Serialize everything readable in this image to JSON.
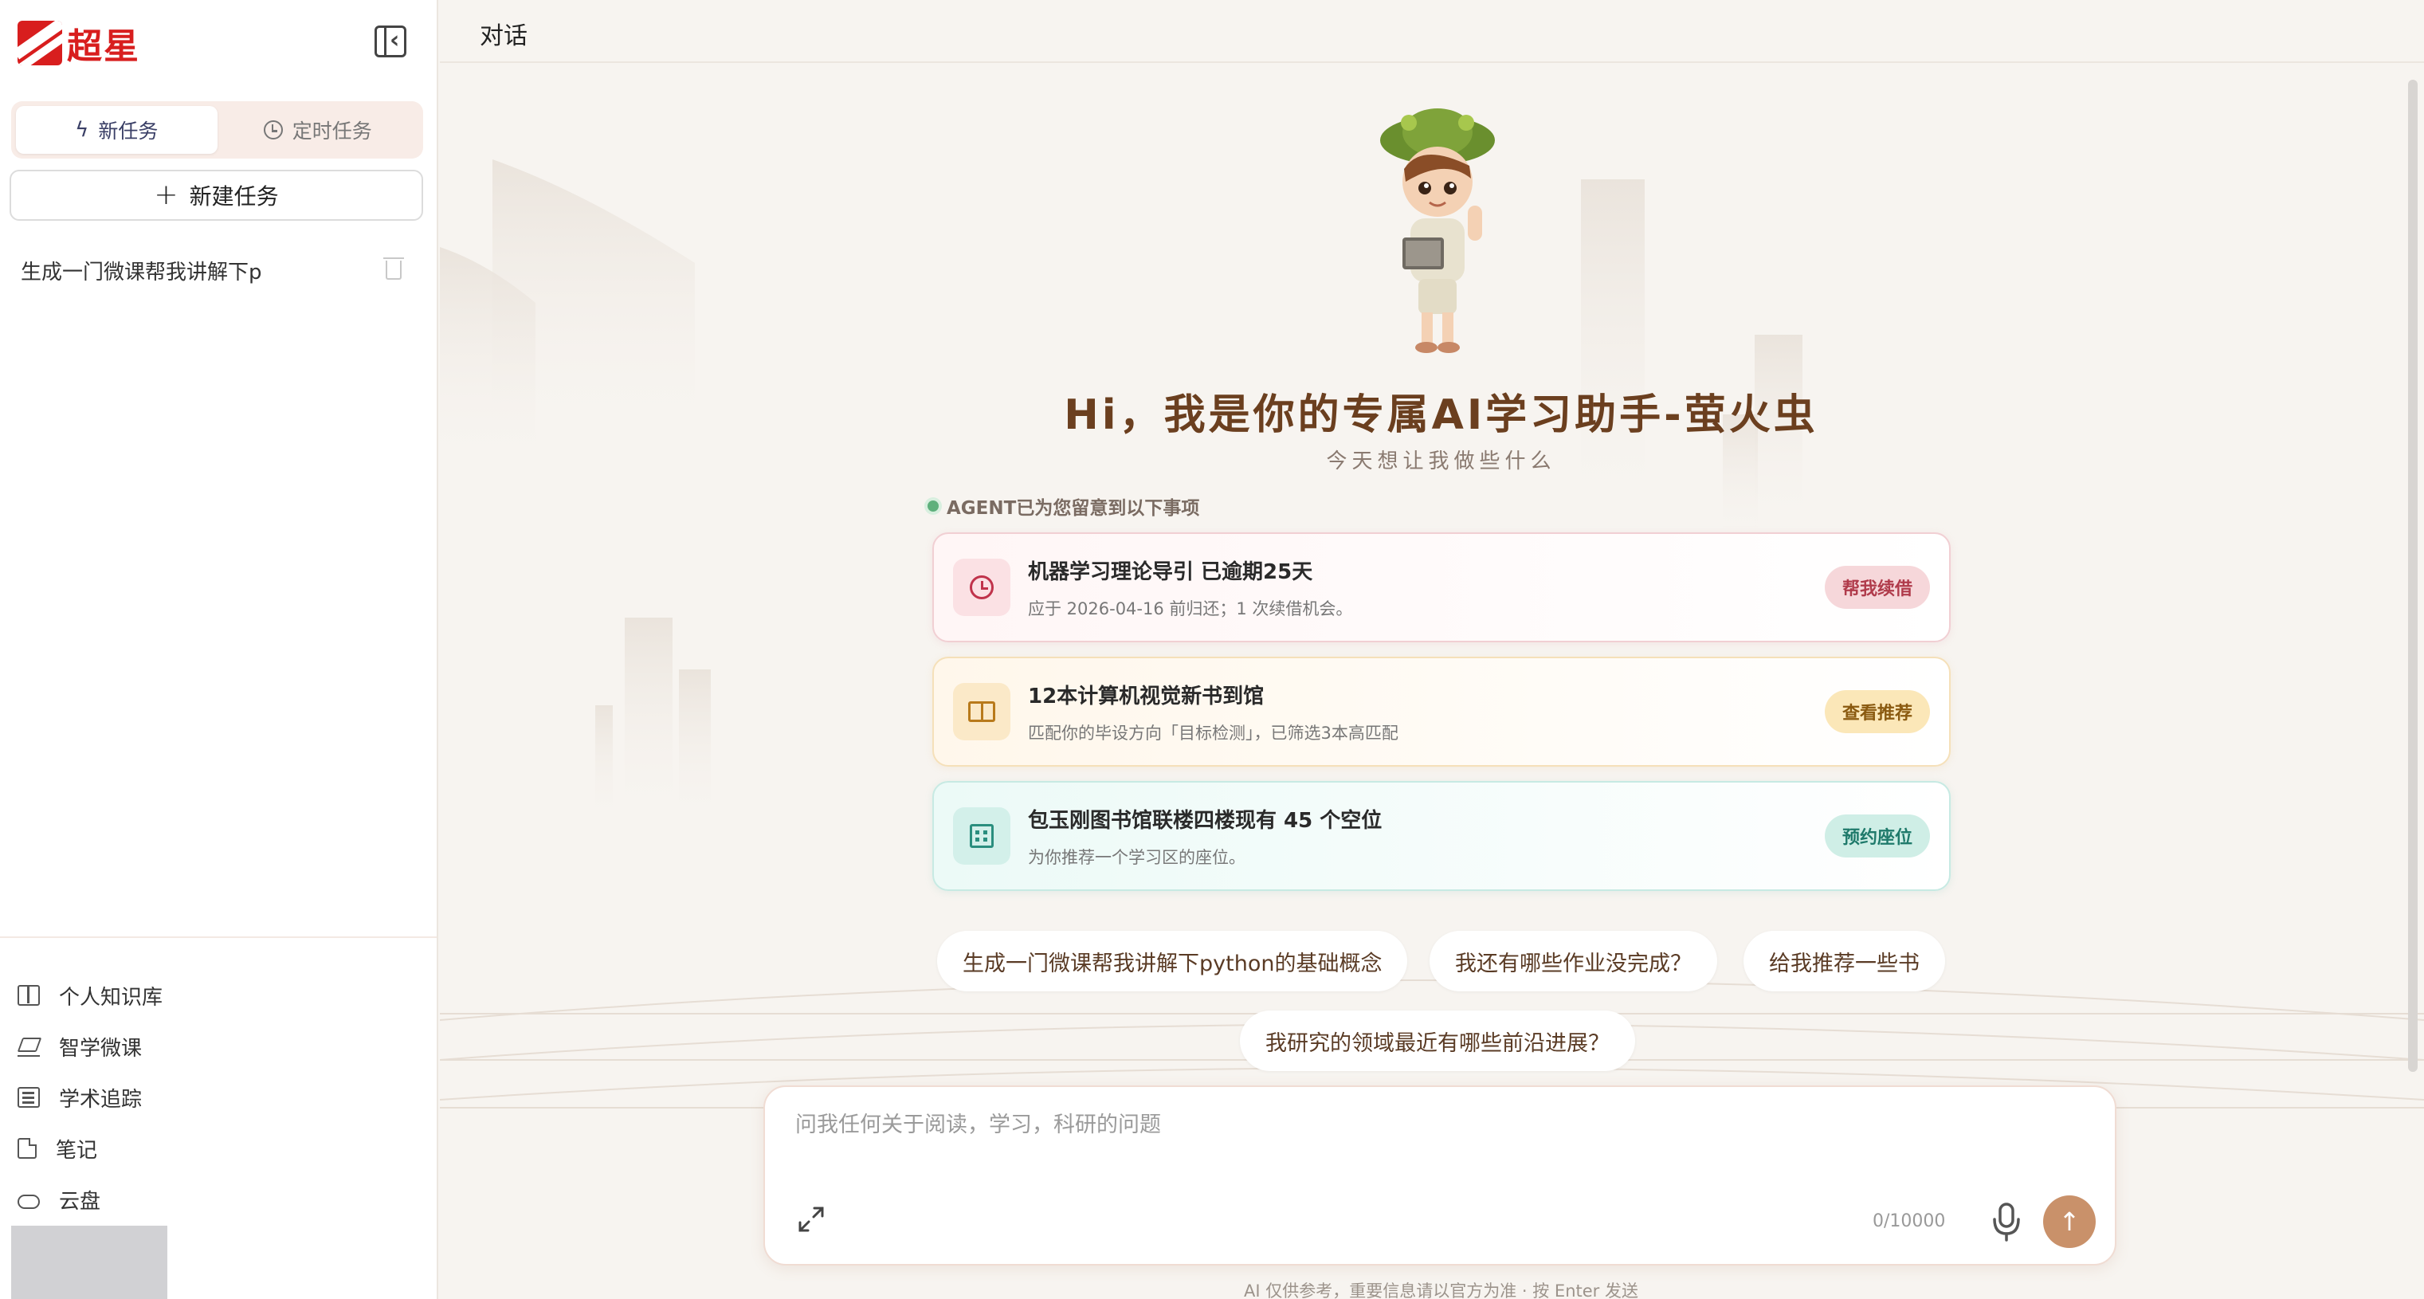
{
  "sidebar": {
    "logo_text": "超星",
    "tabs": [
      {
        "label": "新任务",
        "icon": "bolt-icon",
        "active": true
      },
      {
        "label": "定时任务",
        "icon": "clock-icon",
        "active": false
      }
    ],
    "new_task_label": "新建任务",
    "history": [
      {
        "title": "生成一门微课帮我讲解下p"
      }
    ],
    "nav": [
      {
        "label": "个人知识库",
        "icon": "book-icon"
      },
      {
        "label": "智学微课",
        "icon": "graduation-cap-icon"
      },
      {
        "label": "学术追踪",
        "icon": "newspaper-icon"
      },
      {
        "label": "笔记",
        "icon": "note-icon"
      },
      {
        "label": "云盘",
        "icon": "cloud-icon"
      }
    ]
  },
  "header": {
    "title": "对话"
  },
  "hero": {
    "title": "Hi，我是你的专属AI学习助手-萤火虫",
    "subtitle": "今天想让我做些什么"
  },
  "agent": {
    "label": "AGENT已为您留意到以下事项",
    "cards": [
      {
        "title": "机器学习理论导引 已逾期25天",
        "desc": "应于 2026-04-16 前归还；1 次续借机会。",
        "button": "帮我续借",
        "icon": "clock-icon",
        "accent": "#c0334b"
      },
      {
        "title": "12本计算机视觉新书到馆",
        "desc": "匹配你的毕设方向「目标检测」，已筛选3本高匹配",
        "button": "查看推荐",
        "icon": "book-icon",
        "accent": "#b87a1b"
      },
      {
        "title": "包玉刚图书馆联楼四楼现有 45 个空位",
        "desc": "为你推荐一个学习区的座位。",
        "button": "预约座位",
        "icon": "building-icon",
        "accent": "#2a8e7e"
      }
    ]
  },
  "suggestions": [
    "生成一门微课帮我讲解下python的基础概念",
    "我还有哪些作业没完成？",
    "给我推荐一些书",
    "我研究的领域最近有哪些前沿进展？"
  ],
  "input": {
    "placeholder": "问我任何关于阅读，学习，科研的问题",
    "value": "",
    "counter": "0/10000"
  },
  "footer": {
    "disclaimer": "AI 仅供参考，重要信息请以官方为准 · 按 Enter 发送"
  },
  "colors": {
    "brand_red": "#d81e1e",
    "title_brown": "#6b3f1f",
    "send_button": "#c9916a",
    "page_bg": "#f7f4f0"
  }
}
